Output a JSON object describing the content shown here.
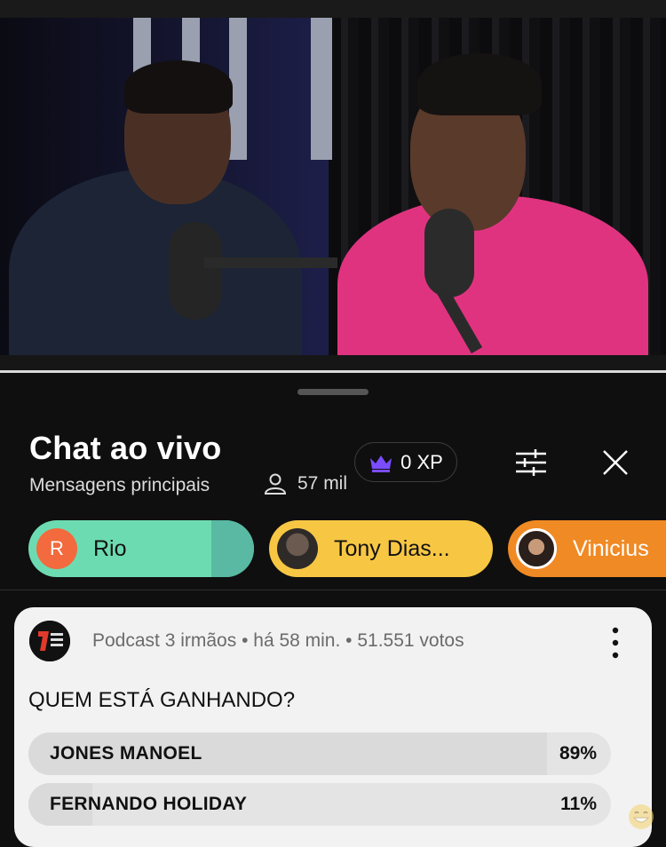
{
  "chat": {
    "title": "Chat ao vivo",
    "subtitle": "Mensagens principais",
    "viewers": "57 mil",
    "xp": "0 XP"
  },
  "icons": {
    "viewers": "person-icon",
    "xp": "crown-icon",
    "settings": "sliders-icon",
    "close": "close-icon",
    "more": "more-vert-icon",
    "emoji": "emoji-icon"
  },
  "members": [
    {
      "initial": "R",
      "name": "Rio",
      "color": "#6ddbb2"
    },
    {
      "name": "Tony Dias...",
      "color": "#f7c744"
    },
    {
      "name": "Vinicius",
      "color": "#f08a24"
    }
  ],
  "poll": {
    "meta": "Podcast 3 irmãos • há 58 min. • 51.551 votos",
    "question": "QUEM ESTÁ GANHANDO?",
    "options": [
      {
        "label": "JONES MANOEL",
        "percent": "89%",
        "value": 0.89
      },
      {
        "label": "FERNANDO HOLIDAY",
        "percent": "11%",
        "value": 0.11
      }
    ]
  }
}
